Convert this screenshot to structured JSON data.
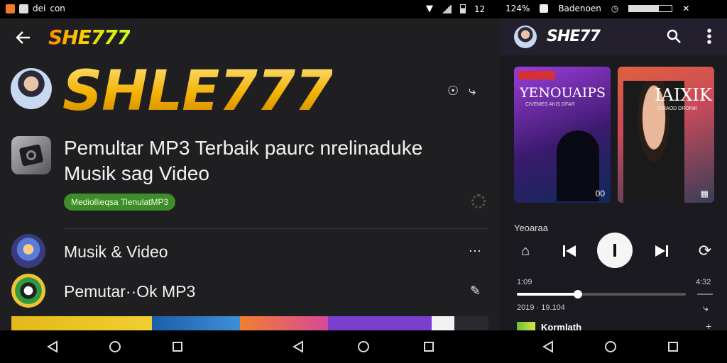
{
  "status_bar": {
    "left_text": "dei",
    "left_text2": "con",
    "mid_time": "12",
    "right_battery_pct": "124%",
    "right_carrier": "Badenoen"
  },
  "left": {
    "header_logo": "SHE777",
    "hero_logo": "SHLE777",
    "app_title": "Pemultar MP3 Terbaik paurc nrelinaduke Musik sag Video",
    "app_title_line1": "Pemultar MP3 Terbaik paurc nrelinaduke",
    "app_title_line2": "Musik sag Video",
    "chip_label": "Mediollieqsa TlenulatMP3",
    "list_items": [
      {
        "label": "Musik & Video"
      },
      {
        "label": "Pemutar··Ok MP3"
      }
    ]
  },
  "right": {
    "header_logo": "SHE77",
    "cards": [
      {
        "title": "YENOUAIPS",
        "subtitle": "CIVEMES AKIS DFAR",
        "badge": "00"
      },
      {
        "title": "IAIXIK",
        "subtitle": "CIRAOD DRONIK"
      }
    ],
    "now_playing_label": "Yeoaraa",
    "time_elapsed": "1:09",
    "time_total": "4:32",
    "progress_fraction": 0.36,
    "meta_line": "2019 · 19.104",
    "next_track_title": "Kormlath"
  },
  "colors": {
    "accent_green": "#3f8c2a",
    "logo_gold": "#f2b000",
    "panel_bg": "#1f1f22",
    "right_bg": "#1b1a20"
  },
  "icons": {
    "back": "arrow-left-icon",
    "share": "share-icon",
    "search": "search-icon",
    "more": "more-vert-icon"
  }
}
